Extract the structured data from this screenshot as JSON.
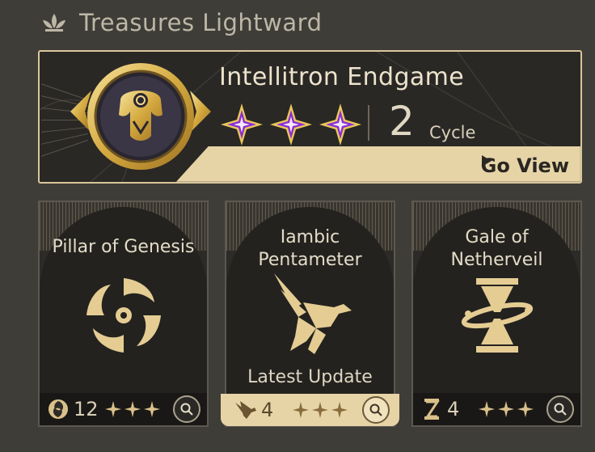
{
  "header": {
    "title": "Treasures Lightward",
    "icon": "lotus-icon"
  },
  "top_card": {
    "title": "Intellitron Endgame",
    "stars": 3,
    "cycle_number": "2",
    "cycle_label": "Cycle",
    "go_view_label": "Go View",
    "emblem": "robot-helm-emblem"
  },
  "cards": [
    {
      "title": "Pillar of Genesis",
      "icon": "vortex-icon",
      "footer_icon": "swirl-icon",
      "count": "12",
      "stars": 3
    },
    {
      "title": "Iambic Pentameter",
      "subtitle": "Latest Update",
      "icon": "bird-icon",
      "footer_icon": "feather-icon",
      "count": "4",
      "stars": 3,
      "highlighted": true
    },
    {
      "title": "Gale of Netherveil",
      "icon": "hourglass-icon",
      "footer_icon": "hourglass-small-icon",
      "count": "4",
      "stars": 3
    }
  ],
  "colors": {
    "gold": "#d9b968",
    "accent_purple": "#8a2bd6",
    "cream": "#e6d4a7",
    "background": "#3f3d38"
  }
}
